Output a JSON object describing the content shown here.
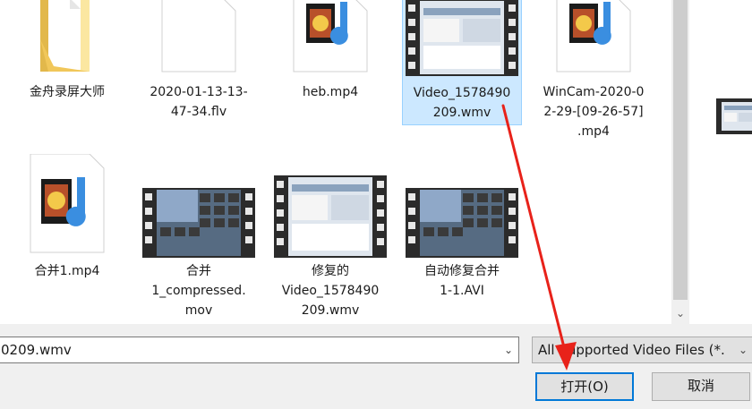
{
  "files": [
    {
      "name": "金舟录屏大师",
      "type": "folder",
      "selected": false
    },
    {
      "name": "2020-01-13-13-\n47-34.flv",
      "type": "blank-document",
      "selected": false
    },
    {
      "name": "heb.mp4",
      "type": "media-file",
      "selected": false
    },
    {
      "name": "Video_1578490\n209.wmv",
      "type": "video-thumbnail-app",
      "selected": true
    },
    {
      "name": "WinCam-2020-0\n2-29-[09-26-57]\n.mp4",
      "type": "media-file",
      "selected": false
    },
    {
      "name": "合并1.mp4",
      "type": "media-file",
      "selected": false
    },
    {
      "name": "合并\n1_compressed.\nmov",
      "type": "video-thumbnail-keyboard",
      "selected": false
    },
    {
      "name": "修复的\nVideo_1578490\n209.wmv",
      "type": "video-thumbnail-app",
      "selected": false
    },
    {
      "name": "自动修复合并\n1-1.AVI",
      "type": "video-thumbnail-keyboard",
      "selected": false
    }
  ],
  "filename_input": {
    "value": "0209.wmv"
  },
  "filetype_select": {
    "value": "All Supported Video Files (*."
  },
  "buttons": {
    "open": "打开(O)",
    "cancel": "取消"
  },
  "icons": {
    "scroll_down": "chevron-down-icon",
    "dropdown": "chevron-down-icon"
  },
  "colors": {
    "selection_bg": "#cce8ff",
    "selection_border": "#99d1ff",
    "accent": "#0078d7",
    "annotation_arrow": "#e8221a"
  }
}
